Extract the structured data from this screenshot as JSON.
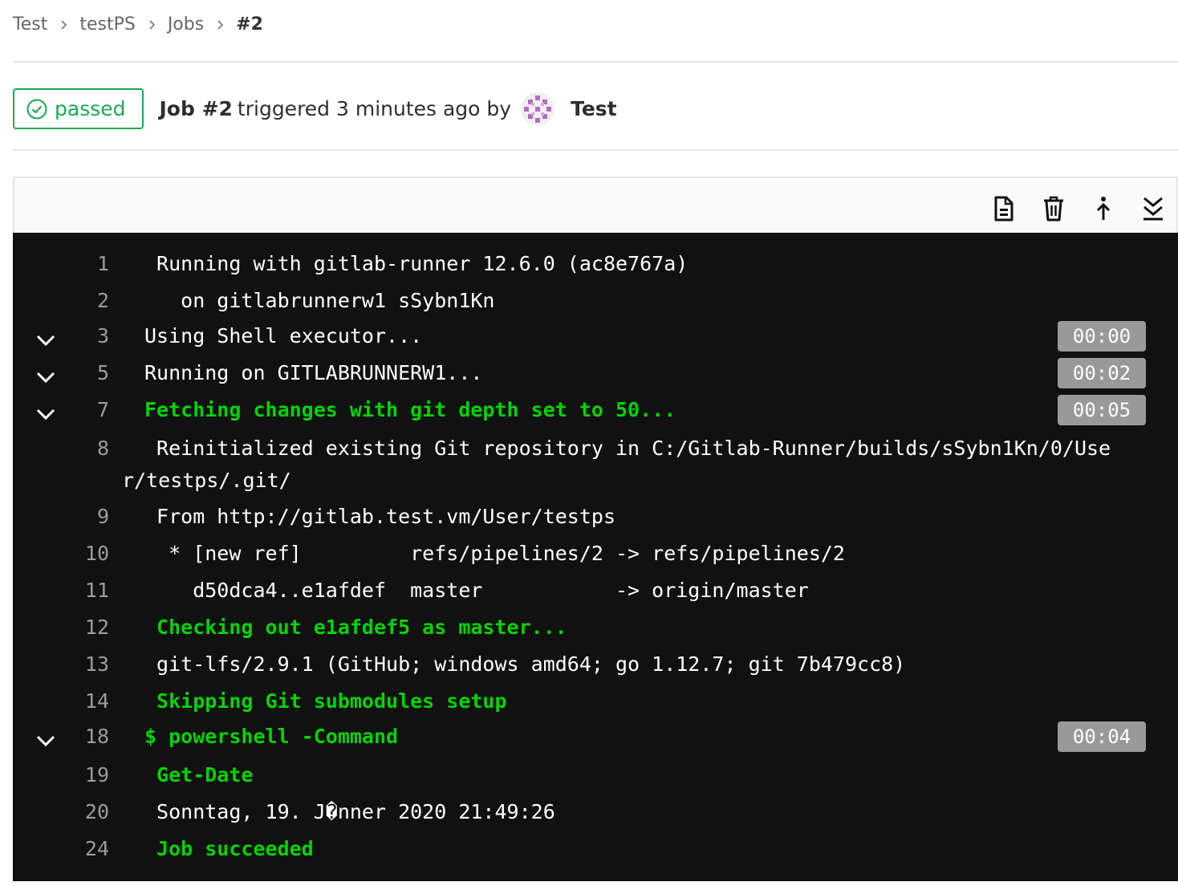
{
  "breadcrumb": {
    "items": [
      "Test",
      "testPS",
      "Jobs",
      "#2"
    ]
  },
  "header": {
    "status": "passed",
    "job_id": "Job #2",
    "triggered_text": "triggered 3 minutes ago by",
    "user": "Test"
  },
  "toolbar": {
    "icons": [
      "raw-log-icon",
      "erase-log-icon",
      "scroll-top-icon",
      "scroll-bottom-icon"
    ]
  },
  "log": {
    "lines": [
      {
        "num": "1",
        "text": " Running with gitlab-runner 12.6.0 (ac8e767a)"
      },
      {
        "num": "2",
        "text": "   on gitlabrunnerw1 sSybn1Kn"
      },
      {
        "num": "3",
        "text": "Using Shell executor...",
        "duration": "00:00"
      },
      {
        "num": "5",
        "text": "Running on GITLABRUNNERW1...",
        "duration": "00:02"
      },
      {
        "num": "7",
        "text": "Fetching changes with git depth set to 50...",
        "duration": "00:05"
      },
      {
        "num": "8",
        "text": " Reinitialized existing Git repository in C:/Gitlab-Runner/builds/sSybn1Kn/0/Use",
        "text2": "r/testps/.git/"
      },
      {
        "num": "9",
        "text": " From http://gitlab.test.vm/User/testps"
      },
      {
        "num": "10",
        "text": "  * [new ref]         refs/pipelines/2 -> refs/pipelines/2"
      },
      {
        "num": "11",
        "text": "    d50dca4..e1afdef  master           -> origin/master"
      },
      {
        "num": "12",
        "text": " Checking out e1afdef5 as master..."
      },
      {
        "num": "13",
        "text": " git-lfs/2.9.1 (GitHub; windows amd64; go 1.12.7; git 7b479cc8)"
      },
      {
        "num": "14",
        "text": " Skipping Git submodules setup"
      },
      {
        "num": "18",
        "text": "$ powershell -Command",
        "duration": "00:04"
      },
      {
        "num": "19",
        "text": " Get-Date"
      },
      {
        "num": "20",
        "text": " Sonntag, 19. J�nner 2020 21:49:26"
      },
      {
        "num": "24",
        "text": " Job succeeded"
      }
    ]
  },
  "colors": {
    "success": "#1aaa55",
    "log_green": "#00d400",
    "log_bg": "#111111",
    "duration_bg": "#999999"
  }
}
